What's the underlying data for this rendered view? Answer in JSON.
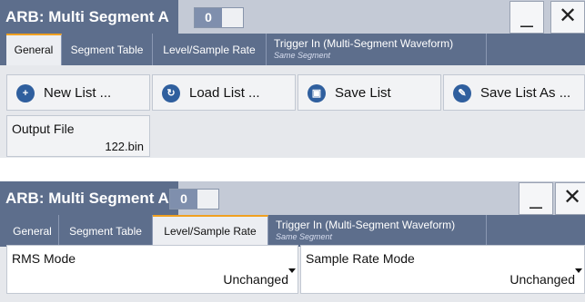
{
  "panel1": {
    "title": "ARB: Multi Segment A",
    "counter": "0",
    "minimize": "_",
    "close": "✕",
    "tabs": [
      "General",
      "Segment Table",
      "Level/Sample Rate",
      "Trigger In (Multi-Segment Waveform)"
    ],
    "trigger_sub": "Same Segment",
    "actions": [
      "New List ...",
      "Load List ...",
      "Save List",
      "Save List As ..."
    ],
    "output_file": {
      "label": "Output File",
      "value": "122.bin"
    }
  },
  "panel2": {
    "title": "ARB: Multi Segment A",
    "counter": "0",
    "minimize": "_",
    "close": "✕",
    "tabs": [
      "General",
      "Segment Table",
      "Level/Sample Rate",
      "Trigger In (Multi-Segment Waveform)"
    ],
    "trigger_sub": "Same Segment",
    "rms_mode": {
      "label": "RMS Mode",
      "value": "Unchanged"
    },
    "sample_rate_mode": {
      "label": "Sample Rate Mode",
      "value": "Unchanged"
    }
  },
  "icons": [
    "new-list-icon",
    "load-list-icon",
    "save-list-icon",
    "save-list-as-icon"
  ]
}
